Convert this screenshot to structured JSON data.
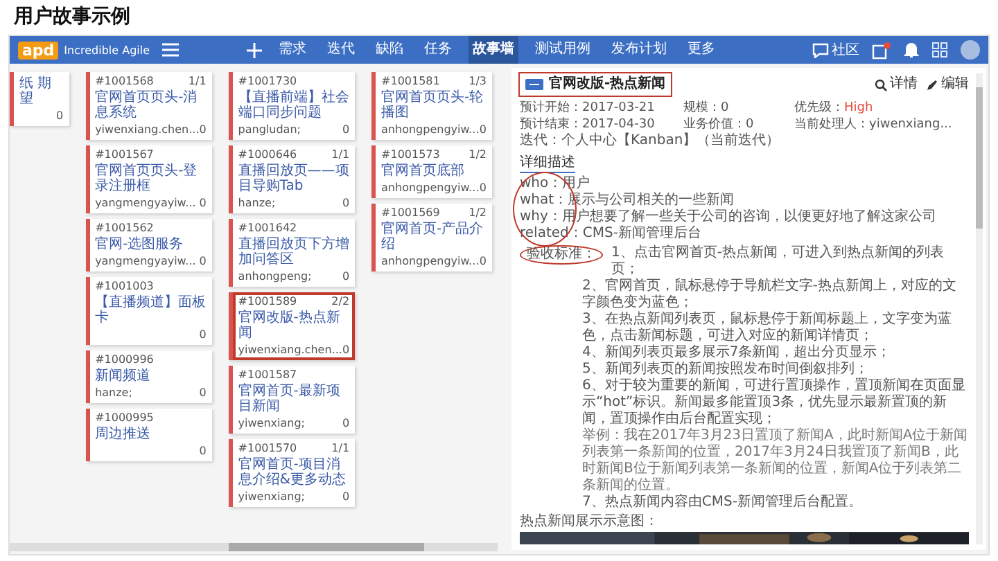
{
  "slide_title": "用户故事示例",
  "app": {
    "logo": "apd",
    "tagline": "Incredible Agile",
    "nav": [
      {
        "label": "需求",
        "selected": false
      },
      {
        "label": "迭代",
        "selected": false
      },
      {
        "label": "缺陷",
        "selected": false
      },
      {
        "label": "任务",
        "selected": false
      },
      {
        "label": "故事墙",
        "selected": true
      },
      {
        "label": "测试用例",
        "selected": false
      },
      {
        "label": "发布计划",
        "selected": false
      },
      {
        "label": "更多",
        "selected": false
      }
    ],
    "community": "社区"
  },
  "columns": [
    {
      "cards": [
        {
          "title": "纸 期望",
          "points": "0",
          "highlighted": false
        }
      ]
    },
    {
      "cards": [
        {
          "id": "#1001568",
          "progress": "1/1",
          "title": "官网首页页头-消息系统",
          "owner": "yiwenxiang.chen...",
          "points": "0",
          "highlighted": false
        },
        {
          "id": "#1001567",
          "title": "官网首页页头-登录注册框",
          "owner": "yangmengyayiw...",
          "points": "0",
          "highlighted": false
        },
        {
          "id": "#1001562",
          "title": "官网-选图服务",
          "owner": "yangmengyayiw...",
          "points": "0",
          "highlighted": false
        },
        {
          "id": "#1001003",
          "title": "【直播频道】面板卡",
          "points": "0",
          "highlighted": false
        },
        {
          "id": "#1000996",
          "title": "新闻频道",
          "owner": "hanze;",
          "points": "0",
          "highlighted": false
        },
        {
          "id": "#1000995",
          "title": "周边推送",
          "points": "0",
          "highlighted": false
        }
      ]
    },
    {
      "cards": [
        {
          "id": "#1001730",
          "title": "【直播前端】社会端口同步问题",
          "owner": "pangludan;",
          "points": "0",
          "highlighted": false
        },
        {
          "id": "#1000646",
          "progress": "1/1",
          "title": "直播回放页——项目导购Tab",
          "owner": "hanze;",
          "points": "0",
          "highlighted": false
        },
        {
          "id": "#1001642",
          "title": "直播回放页下方增加问答区",
          "owner": "anhongpeng;",
          "points": "0",
          "highlighted": false
        },
        {
          "id": "#1001589",
          "progress": "2/2",
          "title": "官网改版-热点新闻",
          "owner": "yiwenxiang.chen...",
          "points": "0",
          "highlighted": true
        },
        {
          "id": "#1001587",
          "title": "官网首页-最新项目新闻",
          "owner": "yiwenxiang;",
          "points": "0",
          "highlighted": false
        },
        {
          "id": "#1001570",
          "progress": "1/1",
          "title": "官网首页-项目消息介绍&更多动态",
          "owner": "yiwenxiang;",
          "points": "0",
          "highlighted": false
        }
      ]
    },
    {
      "cards": [
        {
          "id": "#1001581",
          "progress": "1/3",
          "title": "官网首页页头-轮播图",
          "owner": "anhongpengyiw...",
          "points": "0",
          "highlighted": false
        },
        {
          "id": "#1001573",
          "progress": "1/2",
          "title": "官网首页底部",
          "owner": "anhongpengyiw...",
          "points": "0",
          "highlighted": false
        },
        {
          "id": "#1001569",
          "progress": "1/2",
          "title": "官网首页-产品介绍",
          "owner": "anhongpengyiw...",
          "points": "0",
          "highlighted": false
        }
      ]
    }
  ],
  "detail": {
    "title": "官网改版-热点新闻",
    "highlighted": true,
    "details_link": "详情",
    "edit_link": "编辑",
    "fields": [
      {
        "label": "预计开始：",
        "value": "2017-03-21",
        "alert": false
      },
      {
        "label": "规模：",
        "value": "0",
        "alert": false
      },
      {
        "label": "优先级：",
        "value": "High",
        "alert": true
      },
      {
        "label": "预计结束：",
        "value": "2017-04-30",
        "alert": false
      },
      {
        "label": "业务价值：",
        "value": "0",
        "alert": false
      },
      {
        "label": "当前处理人：",
        "value": "yiwenxiang...",
        "alert": false
      }
    ],
    "iteration": "迭代：个人中心【Kanban】（当前迭代）",
    "section": "详细描述",
    "story": [
      {
        "key": "who",
        "text": "：用户"
      },
      {
        "key": "what",
        "text": "：展示与公司相关的一些新闻"
      },
      {
        "key": "why",
        "text": "：用户想要了解一些关于公司的咨询，以便更好地了解这家公司"
      },
      {
        "key": "related",
        "text": "：CMS-新闻管理后台"
      }
    ],
    "criteria_label": "验收标准：",
    "criteria": [
      {
        "text": "1、点击官网首页-热点新闻，可进入到热点新闻的列表页；"
      },
      {
        "text": "2、官网首页，鼠标悬停于导航栏文字-热点新闻上，对应的文字颜色变为蓝色；"
      },
      {
        "text": "3、在热点新闻列表页，鼠标悬停于新闻标题上，文字变为蓝色，点击新闻标题，可进入对应的新闻详情页；"
      },
      {
        "text": "4、新闻列表页最多展示7条新闻，超出分页显示；"
      },
      {
        "text": "5、新闻列表页的新闻按照发布时间倒叙排列；"
      },
      {
        "text": "6、对于较为重要的新闻，可进行置顶操作，置顶新闻在页面显示“hot”标识。新闻最多能置顶3条，优先显示最新置顶的新闻，置顶操作由后台配置实现；",
        "note": "举例：我在2017年3月23日置顶了新闻A，此时新闻A位于新闻列表第一条新闻的位置，2017年3月24日我置顶了新闻B，此时新闻B位于新闻列表第一条新闻的位置，新闻A位于列表第二条新闻的位置。"
      },
      {
        "text": "7、热点新闻内容由CMS-新闻管理后台配置。"
      }
    ],
    "preview_label": "热点新闻展示示意图："
  }
}
